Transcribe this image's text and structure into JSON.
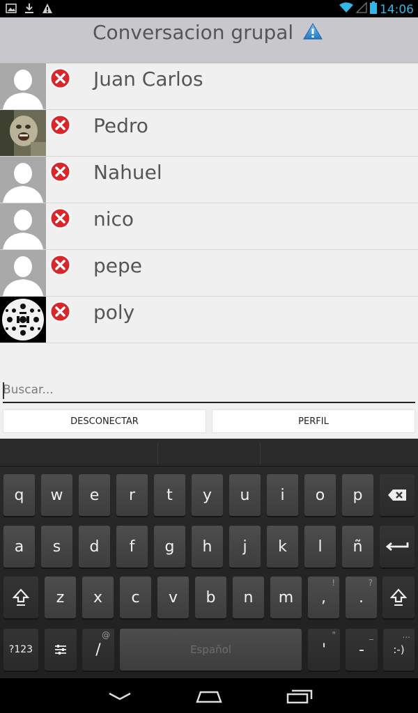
{
  "status_bar": {
    "time": "14:06",
    "left_icons": [
      "gallery-icon",
      "download-icon",
      "warning-icon"
    ],
    "right_icons": [
      "wifi-icon",
      "signal-icon",
      "battery-icon"
    ],
    "accent_color": "#33b5e5"
  },
  "header": {
    "title": "Conversacion grupal",
    "icon": "warning-icon"
  },
  "contacts": [
    {
      "name": "Juan Carlos",
      "avatar": "default-avatar"
    },
    {
      "name": "Pedro",
      "avatar": "photo-avatar"
    },
    {
      "name": "Nahuel",
      "avatar": "default-avatar"
    },
    {
      "name": "nico",
      "avatar": "default-avatar"
    },
    {
      "name": "pepe",
      "avatar": "default-avatar"
    },
    {
      "name": "poly",
      "avatar": "pattern-avatar"
    }
  ],
  "search": {
    "placeholder": "Buscar...",
    "value": ""
  },
  "buttons": {
    "disconnect": "DESCONECTAR",
    "profile": "PERFIL"
  },
  "keyboard": {
    "row1": [
      "q",
      "w",
      "e",
      "r",
      "t",
      "y",
      "u",
      "i",
      "o",
      "p"
    ],
    "row2": [
      "a",
      "s",
      "d",
      "f",
      "g",
      "h",
      "j",
      "k",
      "l",
      "ñ"
    ],
    "row3": [
      "z",
      "x",
      "c",
      "v",
      "b",
      "n",
      "m",
      ",",
      "."
    ],
    "row3_hints": [
      "",
      "",
      "",
      "",
      "",
      "",
      "",
      "!",
      "?"
    ],
    "symbols_label": "?123",
    "slash": "/",
    "slash_hint": "@",
    "space_label": "Español",
    "apostrophe": "'",
    "apostrophe_hint": "\"",
    "dash": "-",
    "dash_hint": "_",
    "smiley": ":-)",
    "smiley_hint": "..."
  }
}
